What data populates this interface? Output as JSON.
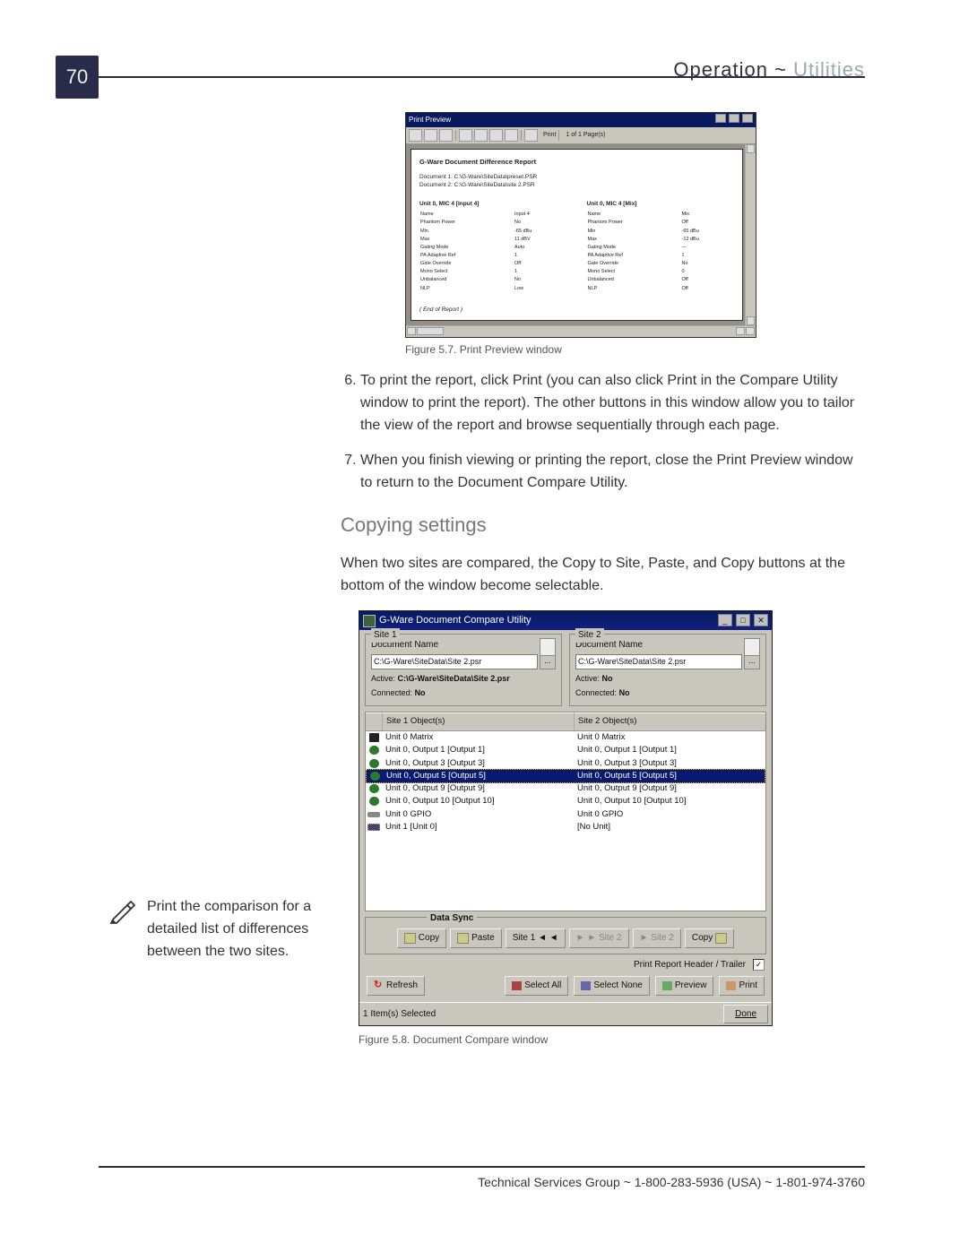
{
  "page_number": "70",
  "header": {
    "left": "Operation",
    "sep": "~",
    "right": "Utilities"
  },
  "fig1": {
    "caption": "Figure 5.7. Print Preview window",
    "title": "Print Preview",
    "toolbar": {
      "print_label": "Print",
      "pages_label": "1 of 1 Page(s)"
    },
    "report_title": "G-Ware Document Difference Report",
    "doc1": "Document 1: C:\\G-Ware\\SiteData\\preset.PSR",
    "doc2": "Document 2: C:\\G-Ware\\SiteData\\site 2.PSR",
    "left_col_title": "Unit 0, MIC 4 [Input 4]",
    "right_col_title": "Unit 0, MIC 4 [Mix]",
    "left_rows": [
      [
        "Name",
        "Input 4"
      ],
      [
        "Phantom Power",
        "No"
      ],
      [
        "Min",
        "-65 dBu"
      ],
      [
        "Max",
        "11 dBV"
      ],
      [
        "Gating Mode",
        "Auto"
      ],
      [
        "PA Adaptive Ref",
        "1"
      ],
      [
        "Gate Override",
        "Off"
      ],
      [
        "Mono Select",
        "1"
      ],
      [
        "Unbalanced",
        "No"
      ],
      [
        "NLP",
        "Low"
      ]
    ],
    "right_rows": [
      [
        "Name",
        "Mix"
      ],
      [
        "Phantom Power",
        "Off"
      ],
      [
        "Min",
        "-65 dBu"
      ],
      [
        "Max",
        "-12 dBu"
      ],
      [
        "Gating Mode",
        "—"
      ],
      [
        "PA Adaptive Ref",
        "1"
      ],
      [
        "Gate Override",
        "No"
      ],
      [
        "Mono Select",
        "0"
      ],
      [
        "Unbalanced",
        "Off"
      ],
      [
        "NLP",
        "Off"
      ]
    ],
    "end": "( End of Report )"
  },
  "steps": {
    "six": "To print the report, click Print (you can also click Print in the Compare Utility window to print the report). The other buttons in this window allow you to tailor the view of the report and browse sequentially through each page.",
    "seven": "When you finish viewing or printing the report, close the Print Preview window to return to the Document Compare Utility."
  },
  "subhead": "Copying settings",
  "para": "When two sites are compared, the Copy to Site, Paste, and Copy buttons at the bottom of the window become selectable.",
  "sidenote": "Print the comparison for a detailed list of differences between the two sites.",
  "fig2": {
    "caption": "Figure 5.8. Document Compare window",
    "title": "G-Ware Document Compare Utility",
    "site1": {
      "legend": "Site 1",
      "docname_label": "Document Name",
      "path": "C:\\G-Ware\\SiteData\\Site 2.psr",
      "active_label": "Active:",
      "active_value": "C:\\G-Ware\\SiteData\\Site 2.psr",
      "connected_label": "Connected:",
      "connected_value": "No"
    },
    "site2": {
      "legend": "Site 2",
      "docname_label": "Document Name",
      "path": "C:\\G-Ware\\SiteData\\Site 2.psr",
      "active_label": "Active:",
      "active_value": "No",
      "connected_label": "Connected:",
      "connected_value": "No"
    },
    "list_headers": {
      "h1": "Site 1 Object(s)",
      "h2": "Site 2 Object(s)"
    },
    "rows": [
      {
        "icon": "matrix",
        "a": "Unit 0 Matrix",
        "b": "Unit 0 Matrix",
        "sel": false
      },
      {
        "icon": "output",
        "a": "Unit 0, Output 1 [Output 1]",
        "b": "Unit 0, Output 1 [Output 1]",
        "sel": false
      },
      {
        "icon": "output",
        "a": "Unit 0, Output 3 [Output 3]",
        "b": "Unit 0, Output 3 [Output 3]",
        "sel": false
      },
      {
        "icon": "output",
        "a": "Unit 0, Output 5 [Output 5]",
        "b": "Unit 0, Output 5 [Output 5]",
        "sel": true
      },
      {
        "icon": "output",
        "a": "Unit 0, Output 9 [Output 9]",
        "b": "Unit 0, Output 9 [Output 9]",
        "sel": false
      },
      {
        "icon": "output",
        "a": "Unit 0, Output 10 [Output 10]",
        "b": "Unit 0, Output 10 [Output 10]",
        "sel": false
      },
      {
        "icon": "gpio",
        "a": "Unit 0 GPIO",
        "b": "Unit 0 GPIO",
        "sel": false
      },
      {
        "icon": "unit",
        "a": "Unit 1 [Unit 0]",
        "b": "[No Unit]",
        "sel": false
      }
    ],
    "sync": {
      "legend": "Data Sync",
      "copy": "Copy",
      "paste": "Paste",
      "site1_btn": "Site 1 ◄ ◄",
      "mid_btn1": "► ► Site 2",
      "mid_btn2": "► Site 2",
      "copy2": "Copy"
    },
    "checkbox_label": "Print Report Header / Trailer",
    "checkbox_checked": "✓",
    "refresh": "Refresh",
    "selectall": "Select All",
    "selectnone": "Select None",
    "preview": "Preview",
    "print": "Print",
    "status": "1 Item(s) Selected",
    "done": "Done"
  },
  "footer": "Technical Services Group ~  1-800-283-5936 (USA) ~  1-801-974-3760"
}
